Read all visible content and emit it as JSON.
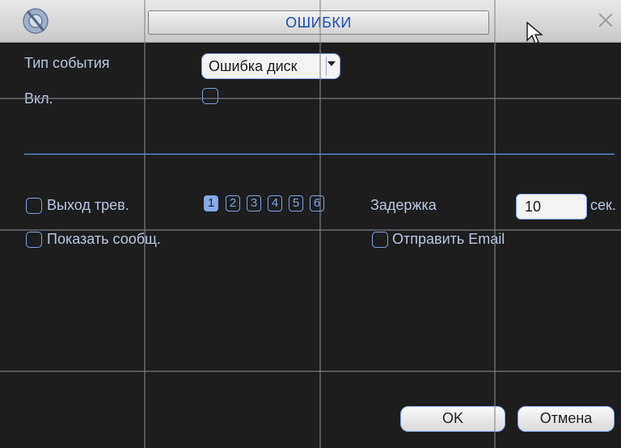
{
  "window": {
    "title": "ОШИБКИ"
  },
  "form": {
    "event_type_label": "Тип события",
    "event_type_value": "Ошибка диск",
    "enable_label": "Вкл.",
    "alarm_out_label": "Выход трев.",
    "alarm_channels": [
      "1",
      "2",
      "3",
      "4",
      "5",
      "6"
    ],
    "alarm_channel_selected": "1",
    "delay_label": "Задержка",
    "delay_value": "10",
    "delay_unit": "сек.",
    "show_message_label": "Показать сообщ.",
    "send_email_label": "Отправить Email"
  },
  "buttons": {
    "ok": "OK",
    "cancel": "Отмена"
  },
  "colors": {
    "background": "#1d1d1d",
    "label": "#b9c6e3",
    "accent": "#7fa3e6",
    "title_text": "#1b4fb3"
  }
}
